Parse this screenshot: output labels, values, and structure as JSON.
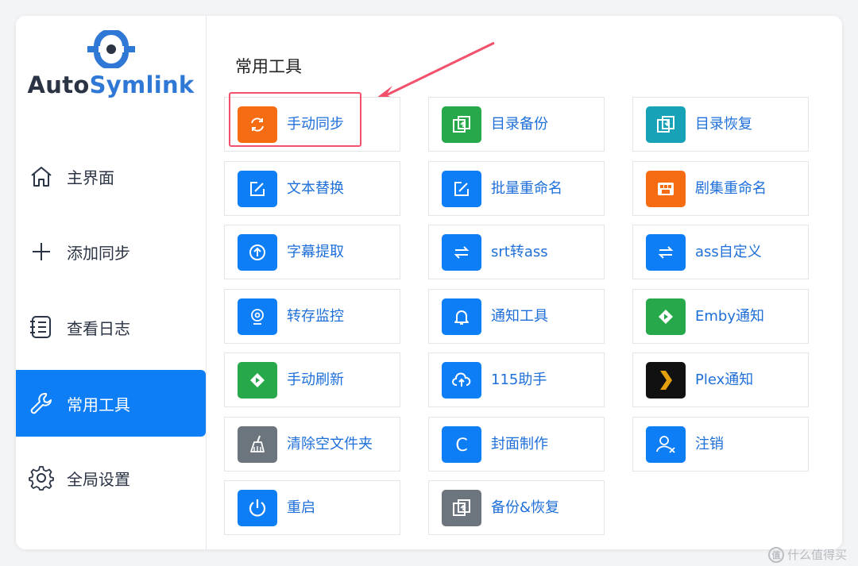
{
  "app": {
    "logo_text_a": "Auto",
    "logo_text_b": "Symlink"
  },
  "sidebar": {
    "items": [
      {
        "label": "主界面",
        "icon": "home-icon",
        "active": false
      },
      {
        "label": "添加同步",
        "icon": "plus-icon",
        "active": false
      },
      {
        "label": "查看日志",
        "icon": "log-icon",
        "active": false
      },
      {
        "label": "常用工具",
        "icon": "wrench-icon",
        "active": true
      },
      {
        "label": "全局设置",
        "icon": "gear-icon",
        "active": false
      }
    ]
  },
  "main": {
    "section_title": "常用工具",
    "tools": [
      {
        "label": "手动同步",
        "icon": "sync-icon",
        "color": "#f56c13"
      },
      {
        "label": "目录备份",
        "icon": "backup-icon",
        "color": "#27a84a"
      },
      {
        "label": "目录恢复",
        "icon": "restore-icon",
        "color": "#17a2b8"
      },
      {
        "label": "文本替换",
        "icon": "edit-icon",
        "color": "#0d7ef5"
      },
      {
        "label": "批量重命名",
        "icon": "edit-icon",
        "color": "#0d7ef5"
      },
      {
        "label": "剧集重命名",
        "icon": "film-icon",
        "color": "#f56c13"
      },
      {
        "label": "字幕提取",
        "icon": "upload-circle-icon",
        "color": "#0d7ef5"
      },
      {
        "label": "srt转ass",
        "icon": "swap-icon",
        "color": "#0d7ef5"
      },
      {
        "label": "ass自定义",
        "icon": "swap-icon",
        "color": "#0d7ef5"
      },
      {
        "label": "转存监控",
        "icon": "webcam-icon",
        "color": "#0d7ef5"
      },
      {
        "label": "通知工具",
        "icon": "bell-icon",
        "color": "#0d7ef5"
      },
      {
        "label": "Emby通知",
        "icon": "emby-icon",
        "color": "#27a84a"
      },
      {
        "label": "手动刷新",
        "icon": "emby-icon",
        "color": "#27a84a"
      },
      {
        "label": "115助手",
        "icon": "cloud-upload-icon",
        "color": "#0d7ef5"
      },
      {
        "label": "Plex通知",
        "icon": "plex-icon",
        "color": "#111111"
      },
      {
        "label": "清除空文件夹",
        "icon": "broom-icon",
        "color": "#6c757d"
      },
      {
        "label": "封面制作",
        "icon": "c-letter-icon",
        "color": "#0d7ef5"
      },
      {
        "label": "注销",
        "icon": "user-x-icon",
        "color": "#0d7ef5"
      },
      {
        "label": "重启",
        "icon": "power-icon",
        "color": "#0d7ef5"
      },
      {
        "label": "备份&恢复",
        "icon": "backup-icon",
        "color": "#6c757d"
      }
    ]
  },
  "watermark": {
    "text": "什么值得买",
    "logo_char": "值"
  }
}
